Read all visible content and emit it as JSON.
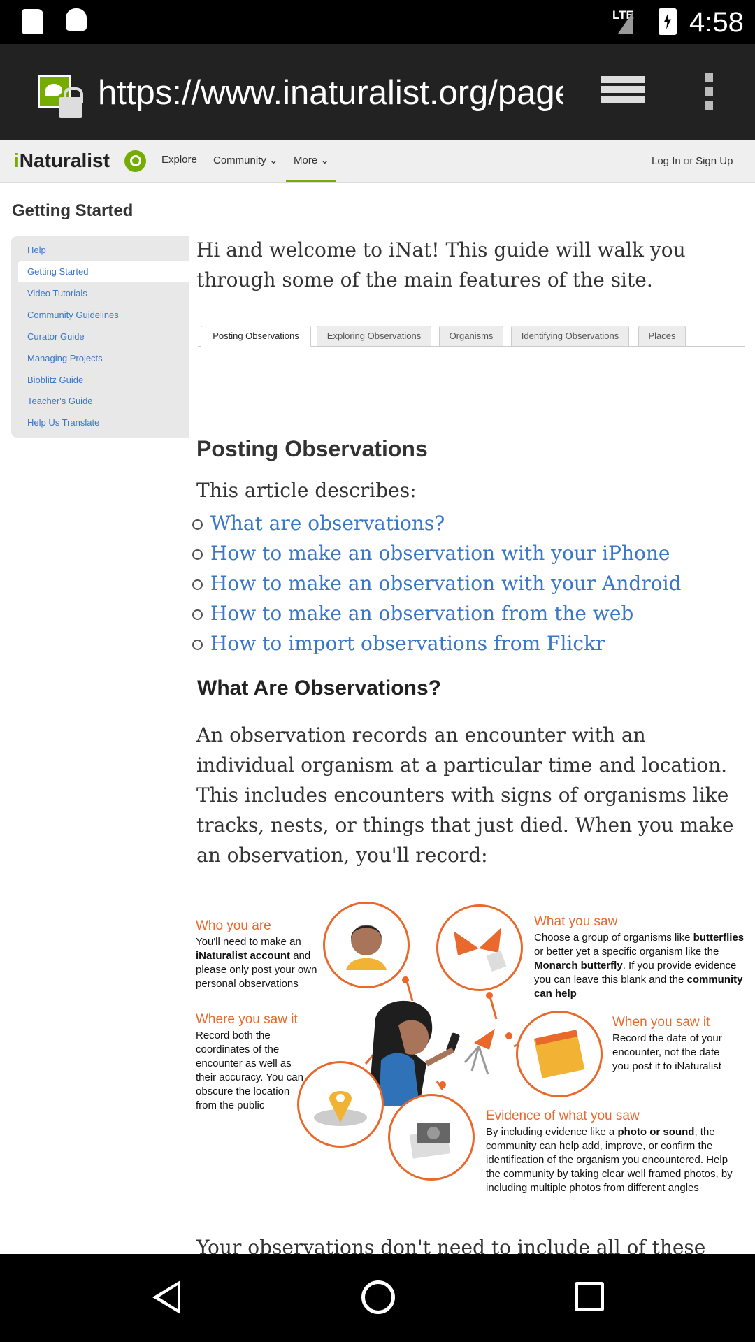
{
  "status_bar": {
    "network": "LTE",
    "time": "4:58"
  },
  "browser": {
    "url": "https://www.inaturalist.org/pages/getting+started"
  },
  "header": {
    "logo_i": "i",
    "logo_rest": "Naturalist",
    "nav": [
      "Explore",
      "Community",
      "More"
    ],
    "login": "Log In",
    "or": "or",
    "signup": "Sign Up"
  },
  "page": {
    "title": "Getting Started"
  },
  "sidebar": {
    "items": [
      {
        "label": "Help"
      },
      {
        "label": "Getting Started"
      },
      {
        "label": "Video Tutorials"
      },
      {
        "label": "Community Guidelines"
      },
      {
        "label": "Curator Guide"
      },
      {
        "label": "Managing Projects"
      },
      {
        "label": "Bioblitz Guide"
      },
      {
        "label": "Teacher's Guide"
      },
      {
        "label": "Help Us Translate"
      }
    ]
  },
  "intro": "Hi and welcome to iNat! This guide will walk you through some of the main features of the site.",
  "tabs": [
    {
      "label": "Posting Observations"
    },
    {
      "label": "Exploring Observations"
    },
    {
      "label": "Organisms"
    },
    {
      "label": "Identifying Observations"
    },
    {
      "label": "Places"
    }
  ],
  "content": {
    "heading": "Posting Observations",
    "describes": "This article describes:",
    "links": [
      "What are observations?",
      "How to make an observation with your iPhone",
      "How to make an observation with your Android",
      "How to make an observation from the web",
      "How to import observations from Flickr"
    ],
    "what_heading": "What Are Observations?",
    "paragraph": "An observation records an encounter with an individual organism at a particular time and location. This includes encounters with signs of organisms like tracks, nests, or things that just died. When you make an observation, you'll record:",
    "cutoff": "Your observations don't need to include all of these"
  },
  "infographic": {
    "who": {
      "h": "Who you are",
      "t1": "You'll need to make an",
      "b1": "iNaturalist account",
      "t2": "and please only post your own personal observations"
    },
    "where": {
      "h": "Where you saw it",
      "t": "Record both the coordinates of the encounter as well as their accuracy. You can obscure the location from the public"
    },
    "what": {
      "h": "What you saw",
      "t1": "Choose a group of organisms like",
      "b1": "butterflies",
      "t2": "or better yet a specific organism like the",
      "b2": "Monarch butterfly",
      "t3": ". If you provide evidence you can leave this blank and the",
      "b3": "community can help"
    },
    "when": {
      "h": "When you saw it",
      "t": "Record the date of your encounter, not the date you post it to iNaturalist"
    },
    "evidence": {
      "h": "Evidence of what you saw",
      "t1": "By including evidence like a",
      "b1": "photo or sound",
      "t2": ", the community can help add, improve, or confirm the identification of the organism you encountered. Help the community by taking clear well framed photos, by including multiple photos from different angles"
    }
  }
}
